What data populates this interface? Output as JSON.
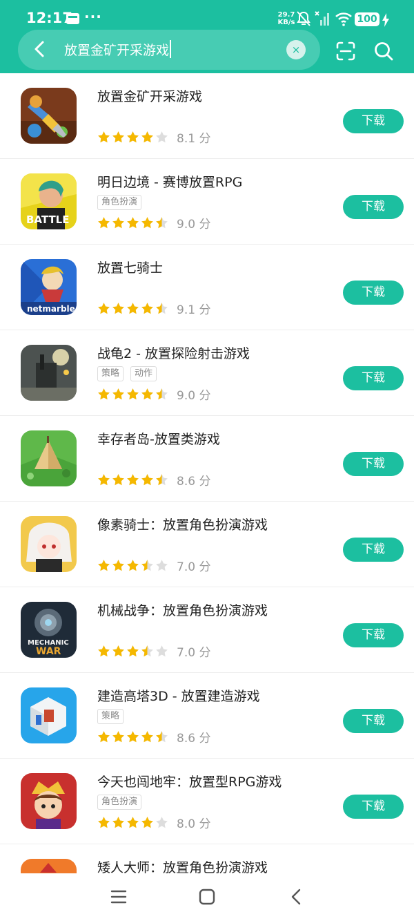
{
  "status_bar": {
    "time": "12:17",
    "more": "···",
    "speed_value": "29.7",
    "speed_unit": "KB/s",
    "battery": "100"
  },
  "search": {
    "query": "放置金矿开采游戏",
    "clear_symbol": "×"
  },
  "icons": {
    "back": "back-arrow-icon",
    "clear": "clear-icon",
    "scan": "scan-icon",
    "search": "search-icon",
    "nav_menu": "menu-icon",
    "nav_home": "home-icon",
    "nav_back": "back-icon"
  },
  "colors": {
    "accent": "#1cbfa0",
    "star_filled": "#f5b800",
    "star_empty": "#dddddd"
  },
  "download_label": "下载",
  "apps": [
    {
      "title": "放置金矿开采游戏",
      "tags": [],
      "stars": 4,
      "score": "8.1 分",
      "icon": "gold-miner-drill-icon"
    },
    {
      "title": "明日边境 - 赛博放置RPG",
      "tags": [
        "角色扮演"
      ],
      "stars": 4.5,
      "score": "9.0 分",
      "icon": "battle-girl-icon"
    },
    {
      "title": "放置七骑士",
      "tags": [],
      "stars": 4.5,
      "score": "9.1 分",
      "icon": "netmarble-knight-icon"
    },
    {
      "title": "战龟2 - 放置探险射击游戏",
      "tags": [
        "策略",
        "动作"
      ],
      "stars": 4.5,
      "score": "9.0 分",
      "icon": "war-turtle-icon"
    },
    {
      "title": "幸存者岛-放置类游戏",
      "tags": [],
      "stars": 4.5,
      "score": "8.6 分",
      "icon": "island-tent-icon"
    },
    {
      "title": "像素骑士：放置角色扮演游戏",
      "tags": [],
      "stars": 3.5,
      "score": "7.0 分",
      "icon": "anime-girl-icon"
    },
    {
      "title": "机械战争：放置角色扮演游戏",
      "tags": [],
      "stars": 3.5,
      "score": "7.0 分",
      "icon": "mechanic-war-icon"
    },
    {
      "title": "建造高塔3D - 放置建造游戏",
      "tags": [
        "策略"
      ],
      "stars": 4.5,
      "score": "8.6 分",
      "icon": "tower-block-icon"
    },
    {
      "title": "今天也闯地牢：放置型RPG游戏",
      "tags": [
        "角色扮演"
      ],
      "stars": 4,
      "score": "8.0 分",
      "icon": "dungeon-hero-icon"
    },
    {
      "title": "矮人大师：放置角色扮演游戏",
      "tags": [],
      "stars": 0,
      "score": "",
      "icon": "dwarf-master-icon"
    }
  ]
}
